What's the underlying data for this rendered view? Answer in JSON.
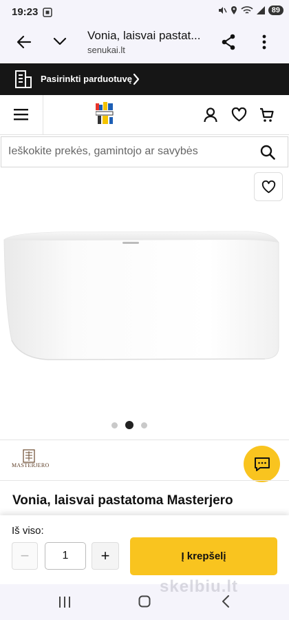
{
  "status_bar": {
    "time": "19:23",
    "battery": "89"
  },
  "browser": {
    "title": "Vonia, laisvai pastat...",
    "url": "senukai.lt"
  },
  "store_bar": {
    "label": "Pasirinkti parduotuvę"
  },
  "search": {
    "placeholder": "Ieškokite prekės, gamintojo ar savybės"
  },
  "gallery": {
    "total": 3,
    "active_index": 1
  },
  "brand": {
    "name": "MASTERJERO"
  },
  "product": {
    "title": "Vonia, laisvai pastatoma Masterjero"
  },
  "purchase": {
    "total_label": "Iš viso:",
    "quantity": "1",
    "minus_label": "−",
    "plus_label": "+",
    "cart_label": "Į krepšelį"
  },
  "watermark": "skelbiu.lt",
  "colors": {
    "accent": "#f9c41f",
    "dark_bar": "#161616"
  },
  "icons": [
    "back-arrow-icon",
    "chevron-down-icon",
    "share-icon",
    "more-vert-icon",
    "store-icon",
    "chevron-right-icon",
    "menu-icon",
    "user-icon",
    "heart-icon",
    "cart-icon",
    "search-icon",
    "chat-icon"
  ]
}
